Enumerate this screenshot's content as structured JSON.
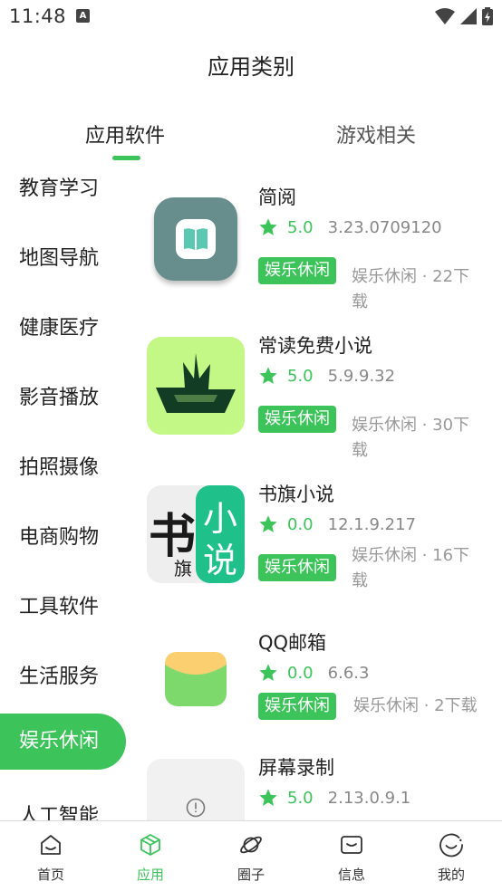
{
  "status_bar": {
    "time": "11:48",
    "notification_letter": "A"
  },
  "header": {
    "title": "应用类别"
  },
  "tabs": [
    {
      "label": "应用软件",
      "selected": true
    },
    {
      "label": "游戏相关",
      "selected": false
    }
  ],
  "categories": [
    {
      "label": "教育学习"
    },
    {
      "label": "地图导航"
    },
    {
      "label": "健康医疗"
    },
    {
      "label": "影音播放"
    },
    {
      "label": "拍照摄像"
    },
    {
      "label": "电商购物"
    },
    {
      "label": "工具软件"
    },
    {
      "label": "生活服务"
    },
    {
      "label": "娱乐休闲",
      "selected": true
    },
    {
      "label": "人工智能"
    }
  ],
  "apps": [
    {
      "name": "简阅",
      "rating": "5.0",
      "version": "3.23.0709120",
      "badge": "娱乐休闲",
      "downloads_line1": "娱乐休闲 · 22下",
      "downloads_line2": "载"
    },
    {
      "name": "常读免费小说",
      "rating": "5.0",
      "version": "5.9.9.32",
      "badge": "娱乐休闲",
      "downloads_line1": "娱乐休闲 · 30下",
      "downloads_line2": "载"
    },
    {
      "name": "书旗小说",
      "rating": "0.0",
      "version": "12.1.9.217",
      "badge": "娱乐休闲",
      "downloads_line1": "娱乐休闲 · 16下",
      "downloads_line2": "载",
      "icon_text": {
        "shu": "书",
        "qi": "旗",
        "xiao": "小",
        "shuo": "说"
      }
    },
    {
      "name": "QQ邮箱",
      "rating": "0.0",
      "version": "6.6.3",
      "badge": "娱乐休闲",
      "downloads_line1": "娱乐休闲 · 2下载"
    },
    {
      "name": "屏幕录制",
      "rating": "5.0",
      "version": "2.13.0.9.1"
    }
  ],
  "bottom_nav": [
    {
      "label": "首页",
      "icon": "home-icon"
    },
    {
      "label": "应用",
      "icon": "cube-icon",
      "selected": true
    },
    {
      "label": "圈子",
      "icon": "planet-icon"
    },
    {
      "label": "信息",
      "icon": "mail-icon"
    },
    {
      "label": "我的",
      "icon": "profile-icon"
    }
  ],
  "colors": {
    "accent": "#3cc45a",
    "text": "#222222",
    "muted": "#888888"
  }
}
